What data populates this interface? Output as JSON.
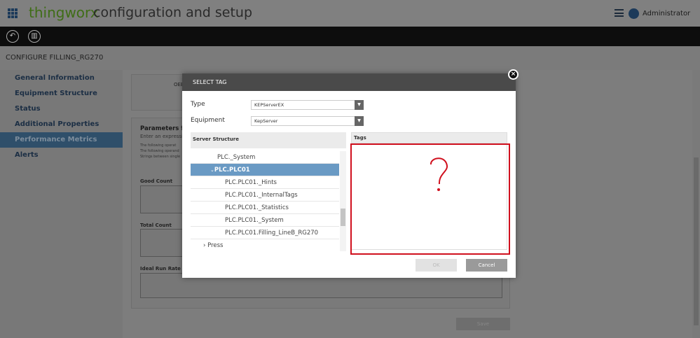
{
  "header": {
    "brand": "thingworx",
    "title": "configuration and setup",
    "user": "Administrator"
  },
  "breadcrumb": "CONFIGURE FILLING_RG270",
  "sidebar": {
    "items": [
      {
        "label": "General Information"
      },
      {
        "label": "Equipment Structure"
      },
      {
        "label": "Status"
      },
      {
        "label": "Additional Properties"
      },
      {
        "label": "Performance Metrics",
        "active": true
      },
      {
        "label": "Alerts"
      }
    ]
  },
  "main": {
    "oee_label": "OEE",
    "params_title": "Parameters for",
    "params_sub": "Enter an expression",
    "help_lines": [
      "The following operat",
      "The following operand",
      "Strings between single"
    ],
    "fields": [
      "Good Count",
      "Total Count",
      "Ideal Run Rate"
    ],
    "save": "Save"
  },
  "dialog": {
    "title": "SELECT TAG",
    "type_label": "Type",
    "type_value": "KEPServerEX",
    "equipment_label": "Equipment",
    "equipment_value": "KepServer",
    "server_structure": "Server Structure",
    "tags": "Tags",
    "tree": [
      {
        "label": "PLC._System",
        "level": 1
      },
      {
        "label": "PLC.PLC01",
        "level": 1,
        "selected": true,
        "expanded": true
      },
      {
        "label": "PLC.PLC01._Hints",
        "level": 2
      },
      {
        "label": "PLC.PLC01._InternalTags",
        "level": 2
      },
      {
        "label": "PLC.PLC01._Statistics",
        "level": 2
      },
      {
        "label": "PLC.PLC01._System",
        "level": 2
      },
      {
        "label": "PLC.PLC01.Filling_LineB_RG270",
        "level": 2
      },
      {
        "label": "Press",
        "level": 0,
        "collapsed": true
      }
    ],
    "ok": "OK",
    "cancel": "Cancel",
    "annotation": "?"
  },
  "colors": {
    "annotation": "#d0101e",
    "selected": "#6a9ac4",
    "brand": "#3f6d16"
  }
}
